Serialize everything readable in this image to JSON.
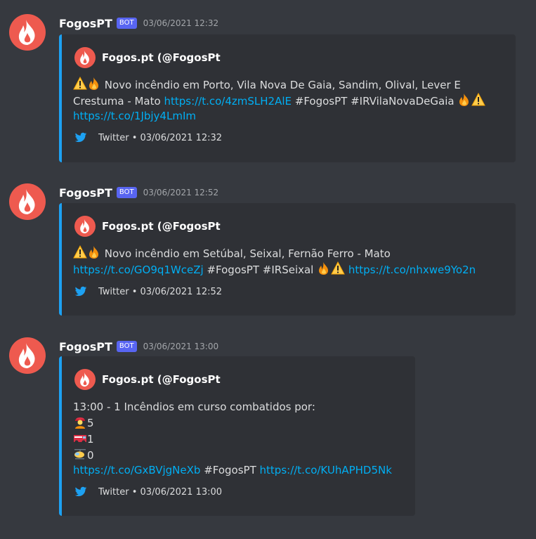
{
  "messages": [
    {
      "username": "FogosPT",
      "bot_tag": "BOT",
      "timestamp": "03/06/2021 12:32",
      "author": "Fogos.pt (@FogosPt",
      "desc1": " Novo incêndio em Porto, Vila Nova De Gaia, Sandim, Olival, Lever E",
      "desc2a": "Crestuma - Mato ",
      "link1": "https://t.co/4zmSLH2AlE",
      "desc2b": " #FogosPT #IRVilaNovaDeGaia ",
      "link2": "https://t.co/1Jbjy4LmIm",
      "footer": "Twitter • 03/06/2021 12:32"
    },
    {
      "username": "FogosPT",
      "bot_tag": "BOT",
      "timestamp": "03/06/2021 12:52",
      "author": "Fogos.pt (@FogosPt",
      "desc1": " Novo incêndio em Setúbal, Seixal, Fernão Ferro - Mato",
      "link1": "https://t.co/GO9q1WceZj",
      "desc2b": " #FogosPT #IRSeixal ",
      "link2": "https://t.co/nhxwe9Yo2n",
      "footer": "Twitter • 03/06/2021 12:52"
    },
    {
      "username": "FogosPT",
      "bot_tag": "BOT",
      "timestamp": "03/06/2021 13:00",
      "author": "Fogos.pt (@FogosPt",
      "desc1": "13:00 - 1 Incêndios em curso combatidos por:",
      "count_firefighters": "5",
      "count_trucks": "1",
      "count_helicopters": "0",
      "link1": "https://t.co/GxBVjgNeXb",
      "desc2b": " #FogosPT ",
      "link2": "https://t.co/KUhAPHD5Nk",
      "footer": "Twitter • 03/06/2021 13:00"
    }
  ],
  "colors": {
    "background": "#36393f",
    "embed": "#2f3136",
    "accent": "#1da1f2",
    "link": "#00aff4",
    "bot": "#5865f2",
    "avatar": "#ee5a4f"
  }
}
